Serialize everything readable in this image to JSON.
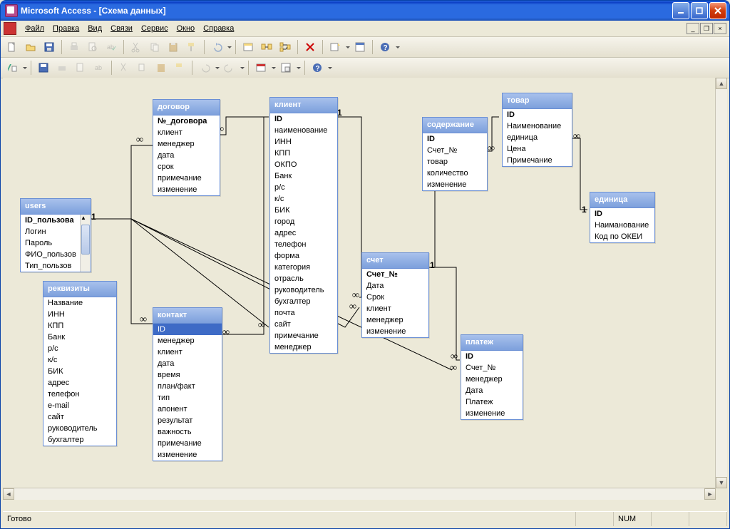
{
  "title": "Microsoft Access - [Схема данных]",
  "menu": [
    "Файл",
    "Правка",
    "Вид",
    "Связи",
    "Сервис",
    "Окно",
    "Справка"
  ],
  "status": {
    "ready": "Готово",
    "num": "NUM"
  },
  "tables": {
    "users": {
      "title": "users",
      "fields": [
        "ID_пользова",
        "Логин",
        "Пароль",
        "ФИО_пользов",
        "Тип_пользов"
      ],
      "pk": [
        0
      ]
    },
    "rekvizity": {
      "title": "реквизиты",
      "fields": [
        "Название",
        "ИНН",
        "КПП",
        "Банк",
        "р/с",
        "к/с",
        "БИК",
        "адрес",
        "телефон",
        "e-mail",
        "сайт",
        "руководитель",
        "бухгалтер"
      ]
    },
    "dogovor": {
      "title": "договор",
      "fields": [
        "№_договора",
        "клиент",
        "менеджер",
        "дата",
        "срок",
        "примечание",
        "изменение"
      ],
      "pk": [
        0
      ]
    },
    "kontakt": {
      "title": "контакт",
      "fields": [
        "ID",
        "менеджер",
        "клиент",
        "дата",
        "время",
        "план/факт",
        "тип",
        "апонент",
        "результат",
        "важность",
        "примечание",
        "изменение"
      ],
      "sel": [
        0
      ]
    },
    "klient": {
      "title": "клиент",
      "fields": [
        "ID",
        "наименование",
        "ИНН",
        "КПП",
        "ОКПО",
        "Банк",
        "р/с",
        "к/с",
        "БИК",
        "город",
        "адрес",
        "телефон",
        "форма",
        "категория",
        "отрасль",
        "руководитель",
        "бухгалтер",
        "почта",
        "сайт",
        "примечание",
        "менеджер"
      ],
      "pk": [
        0
      ]
    },
    "schet": {
      "title": "счет",
      "fields": [
        "Счет_№",
        "Дата",
        "Срок",
        "клиент",
        "менеджер",
        "изменение"
      ],
      "pk": [
        0
      ]
    },
    "soderzhanie": {
      "title": "содержание",
      "fields": [
        "ID",
        "Счет_№",
        "товар",
        "количество",
        "изменение"
      ],
      "pk": [
        0
      ]
    },
    "tovar": {
      "title": "товар",
      "fields": [
        "ID",
        "Наименование",
        "единица",
        "Цена",
        "Примечание"
      ],
      "pk": [
        0
      ]
    },
    "edinica": {
      "title": "единица",
      "fields": [
        "ID",
        "Наиманование",
        "Код по ОКЕИ"
      ],
      "pk": [
        0
      ]
    },
    "platezh": {
      "title": "платеж",
      "fields": [
        "ID",
        "Счет_№",
        "менеджер",
        "Дата",
        "Платеж",
        "изменение"
      ],
      "pk": [
        0
      ]
    }
  },
  "relationships": [
    {
      "from": "users.ID_пользова",
      "to": "dogovor.менеджер",
      "card": [
        "1",
        "∞"
      ]
    },
    {
      "from": "users.ID_пользова",
      "to": "kontakt.менеджер",
      "card": [
        "1",
        "∞"
      ]
    },
    {
      "from": "users.ID_пользова",
      "to": "klient.менеджер",
      "card": [
        "1",
        "∞"
      ]
    },
    {
      "from": "users.ID_пользова",
      "to": "schet.менеджер",
      "card": [
        "1",
        "∞"
      ]
    },
    {
      "from": "users.ID_пользова",
      "to": "platezh.менеджер",
      "card": [
        "1",
        "∞"
      ]
    },
    {
      "from": "klient.ID",
      "to": "dogovor.клиент",
      "card": [
        "1",
        "∞"
      ]
    },
    {
      "from": "klient.ID",
      "to": "kontakt.клиент",
      "card": [
        "1",
        "∞"
      ]
    },
    {
      "from": "klient.ID",
      "to": "schet.клиент",
      "card": [
        "1",
        "∞"
      ]
    },
    {
      "from": "schet.Счет_№",
      "to": "soderzhanie.Счет_№",
      "card": [
        "1",
        "∞"
      ]
    },
    {
      "from": "schet.Счет_№",
      "to": "platezh.Счет_№",
      "card": [
        "1",
        "∞"
      ]
    },
    {
      "from": "tovar.ID",
      "to": "soderzhanie.товар",
      "card": [
        "1",
        "∞"
      ]
    },
    {
      "from": "edinica.ID",
      "to": "tovar.единица",
      "card": [
        "1",
        "∞"
      ]
    }
  ]
}
